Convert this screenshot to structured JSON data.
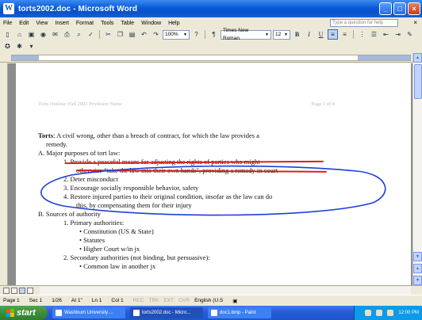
{
  "window": {
    "title": "torts2002.doc - Microsoft Word",
    "app_icon": "W"
  },
  "menu": [
    "File",
    "Edit",
    "View",
    "Insert",
    "Format",
    "Tools",
    "Table",
    "Window",
    "Help"
  ],
  "help_box_placeholder": "Type a question for help",
  "toolbar": {
    "zoom": "100%",
    "font": "Times New Roman",
    "size": "12",
    "bold": "B",
    "italic": "I",
    "underline": "U"
  },
  "document": {
    "header_left": "Torts Outline: Fall 2002 Professor Name",
    "header_right": "Page 1 of 8",
    "lines": [
      {
        "text_bold": "Torts",
        "text": ": A civil wrong, other than a breach of contract, for which the law provides a"
      },
      {
        "text": "remedy."
      },
      {
        "text": "A. Major purposes of tort law:"
      },
      {
        "text": "1.  Provide a peaceful means for adjusting the rights of parties who might"
      },
      {
        "text": "otherwise \"take the law into their own hands\", providing a remedy in court"
      },
      {
        "text": "2.  Deter misconduct"
      },
      {
        "text": "3.  Encourage socially responsible behavior, safety"
      },
      {
        "text": "4.  Restore injured parties to their original condition, insofar as the law can do"
      },
      {
        "text": "this, by compensating them for their injury"
      },
      {
        "text": "B. Sources of authority"
      },
      {
        "text": "1.  Primary authorities:"
      },
      {
        "text": "•    Constitution (US & State)"
      },
      {
        "text": "•    Statutes"
      },
      {
        "text": "•    Higher Court w/in jx"
      },
      {
        "text": "2.  Secondary authorities (not binding, but persuasive):"
      },
      {
        "text": "•    Common law in another jx"
      }
    ]
  },
  "status": {
    "page": "Page 1",
    "sec": "Sec 1",
    "pages": "1/26",
    "at": "At 1\"",
    "ln": "Ln 1",
    "col": "Col 1",
    "rec": "REC",
    "trk": "TRK",
    "ext": "EXT",
    "ovr": "OVR",
    "language": "English (U.S"
  },
  "taskbar": {
    "start": "start",
    "tasks": [
      "Washburn University ...",
      "torts2002.doc - Micro...",
      "doc1.bmp - Paint"
    ],
    "clock": "12:00 PM"
  },
  "colors": {
    "titlebar": "#0a5ad8",
    "annotation_red": "#d8211c",
    "annotation_blue": "#1c3fd8",
    "start_green": "#3b8e3b"
  }
}
